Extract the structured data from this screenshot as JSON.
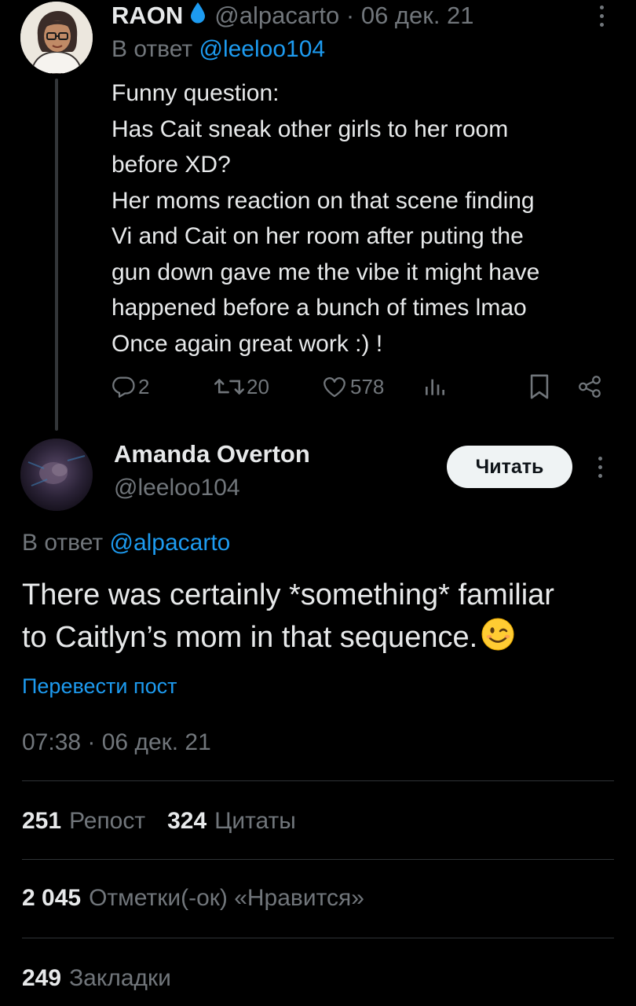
{
  "parent_tweet": {
    "author_name": "RAON",
    "author_handle": "@alpacarto",
    "date": "· 06 дек. 21",
    "reply_prefix": "В ответ",
    "reply_to": "@leeloo104",
    "lines": [
      "Funny question:",
      "Has Cait sneak other girls to her room",
      "before XD?",
      "Her moms reaction on that scene finding",
      "Vi and Cait on her room after puting the",
      "gun down gave me the vibe it might have",
      "happened before a bunch of times lmao",
      "Once again great work :) !"
    ],
    "actions": {
      "replies": "2",
      "reposts": "20",
      "likes": "578"
    },
    "icons": [
      "droplet-icon",
      "reply-icon",
      "repost-icon",
      "like-icon",
      "views-icon",
      "bookmark-icon",
      "share-icon"
    ]
  },
  "main_tweet": {
    "author_name": "Amanda Overton",
    "author_handle": "@leeloo104",
    "follow_label": "Читать",
    "reply_prefix": "В ответ",
    "reply_to": "@alpacarto",
    "body_lines": [
      "There was certainly *something* familiar",
      "to Caitlyn’s mom in that sequence."
    ],
    "emoji": "winking-face",
    "translate_label": "Перевести пост",
    "timestamp": "07:38 · 06 дек. 21",
    "stats": {
      "reposts_count": "251",
      "reposts_label": "Репост",
      "quotes_count": "324",
      "quotes_label": "Цитаты",
      "likes_count": "2 045",
      "likes_label": "Отметки(-ок) «Нравится»",
      "bookmarks_count": "249",
      "bookmarks_label": "Закладки"
    }
  },
  "colors": {
    "background": "#000000",
    "text_primary": "#e7e9ea",
    "text_secondary": "#71767b",
    "accent": "#1d9bf0",
    "divider": "#2f3336",
    "button_bg": "#eff3f4"
  }
}
